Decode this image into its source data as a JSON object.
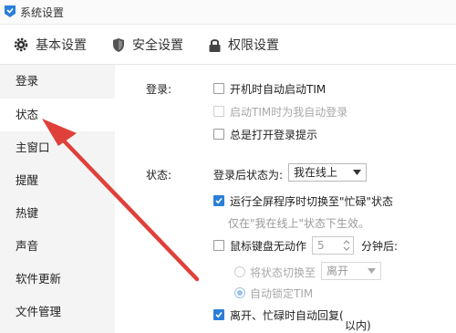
{
  "window": {
    "title": "系统设置"
  },
  "tabs": [
    {
      "label": "基本设置",
      "icon": "gear-icon"
    },
    {
      "label": "安全设置",
      "icon": "shield-icon"
    },
    {
      "label": "权限设置",
      "icon": "lock-icon"
    }
  ],
  "sidebar": {
    "items": [
      {
        "label": "登录"
      },
      {
        "label": "状态"
      },
      {
        "label": "主窗口"
      },
      {
        "label": "提醒"
      },
      {
        "label": "热键"
      },
      {
        "label": "声音"
      },
      {
        "label": "软件更新"
      },
      {
        "label": "文件管理"
      }
    ],
    "active": "状态"
  },
  "login_section": {
    "label": "登录:",
    "options": [
      {
        "label": "开机时自动启动TIM",
        "checked": false,
        "disabled": false
      },
      {
        "label": "启动TIM时为我自动登录",
        "checked": false,
        "disabled": true
      },
      {
        "label": "总是打开登录提示",
        "checked": false,
        "disabled": false
      }
    ]
  },
  "status_section": {
    "label": "状态:",
    "after_login_label": "登录后状态为:",
    "after_login_value": "我在线上",
    "fullscreen_option": {
      "label": "运行全屏程序时切换至\"忙碌\"状态",
      "checked": true
    },
    "fullscreen_hint": "仅在\"我在线上\"状态下生效。",
    "idle_option": {
      "label": "鼠标键盘无动作",
      "checked": false
    },
    "idle_minutes": "5",
    "idle_suffix": "分钟后:",
    "switch_radio": {
      "label": "将状态切换至",
      "selected": false
    },
    "switch_value": "离开",
    "lock_radio": {
      "label": "自动锁定TIM",
      "selected": true
    },
    "auto_reply": {
      "label": "离开、忙碌时自动回复(",
      "checked": true
    },
    "auto_reply_suffix": "以内)"
  },
  "colors": {
    "accent": "#2b7fd8",
    "annotation": "#e0403a"
  }
}
